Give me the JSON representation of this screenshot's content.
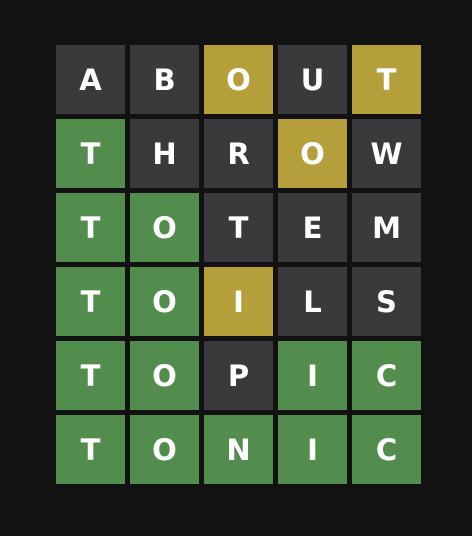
{
  "colors": {
    "background": "#121213",
    "absent": "#3a3a3c",
    "present": "#b59f3b",
    "correct": "#538d4e",
    "letter": "#ffffff"
  },
  "board": {
    "rows": [
      {
        "letters": [
          "A",
          "B",
          "O",
          "U",
          "T"
        ],
        "states": [
          "absent",
          "absent",
          "present",
          "absent",
          "present"
        ]
      },
      {
        "letters": [
          "T",
          "H",
          "R",
          "O",
          "W"
        ],
        "states": [
          "correct",
          "absent",
          "absent",
          "present",
          "absent"
        ]
      },
      {
        "letters": [
          "T",
          "O",
          "T",
          "E",
          "M"
        ],
        "states": [
          "correct",
          "correct",
          "absent",
          "absent",
          "absent"
        ]
      },
      {
        "letters": [
          "T",
          "O",
          "I",
          "L",
          "S"
        ],
        "states": [
          "correct",
          "correct",
          "present",
          "absent",
          "absent"
        ]
      },
      {
        "letters": [
          "T",
          "O",
          "P",
          "I",
          "C"
        ],
        "states": [
          "correct",
          "correct",
          "absent",
          "correct",
          "correct"
        ]
      },
      {
        "letters": [
          "T",
          "O",
          "N",
          "I",
          "C"
        ],
        "states": [
          "correct",
          "correct",
          "correct",
          "correct",
          "correct"
        ]
      }
    ]
  }
}
